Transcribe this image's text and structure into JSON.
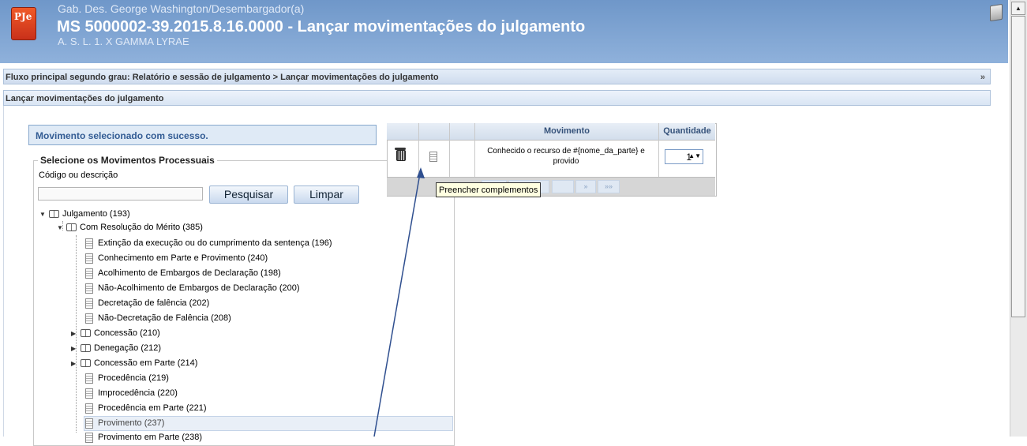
{
  "header": {
    "logo_text": "PJe",
    "subtitle": "Gab. Des. George Washington/Desembargador(a)",
    "title": "MS 5000002-39.2015.8.16.0000 - Lançar movimentações do julgamento",
    "parties": "A. S. L. 1. X GAMMA LYRAE"
  },
  "breadcrumb": "Fluxo principal segundo grau: Relatório e sessão de julgamento > Lançar movimentações do julgamento",
  "breadcrumb_more": "»",
  "section_title": "Lançar movimentações do julgamento",
  "success_message": "Movimento selecionado com sucesso.",
  "selector": {
    "legend": "Selecione os Movimentos Processuais",
    "search_label": "Código ou descrição",
    "search_value": "",
    "search_button": "Pesquisar",
    "clear_button": "Limpar"
  },
  "tree": {
    "root": "Julgamento (193)",
    "group": "Com Resolução do Mérito (385)",
    "items": [
      {
        "label": "Extinção da execução ou do cumprimento da sentença (196)",
        "type": "leaf"
      },
      {
        "label": "Conhecimento em Parte e Provimento (240)",
        "type": "leaf"
      },
      {
        "label": "Acolhimento de Embargos de Declaração (198)",
        "type": "leaf"
      },
      {
        "label": "Não-Acolhimento de Embargos de Declaração (200)",
        "type": "leaf"
      },
      {
        "label": "Decretação de falência (202)",
        "type": "leaf"
      },
      {
        "label": "Não-Decretação de Falência (208)",
        "type": "leaf"
      },
      {
        "label": "Concessão (210)",
        "type": "folder"
      },
      {
        "label": "Denegação (212)",
        "type": "folder"
      },
      {
        "label": "Concessão em Parte (214)",
        "type": "folder"
      },
      {
        "label": "Procedência (219)",
        "type": "leaf"
      },
      {
        "label": "Improcedência (220)",
        "type": "leaf"
      },
      {
        "label": "Procedência em Parte (221)",
        "type": "leaf"
      },
      {
        "label": "Provimento (237)",
        "type": "leaf",
        "selected": true
      },
      {
        "label": "Provimento em Parte (238)",
        "type": "leaf"
      }
    ]
  },
  "grid": {
    "col_movimento": "Movimento",
    "col_quantidade": "Quantidade",
    "row": {
      "movimento": "Conhecido o recurso de #{nome_da_parte} e provido",
      "quantidade": "1"
    },
    "pager": [
      "»",
      "»»"
    ]
  },
  "tooltip": "Preencher complementos"
}
